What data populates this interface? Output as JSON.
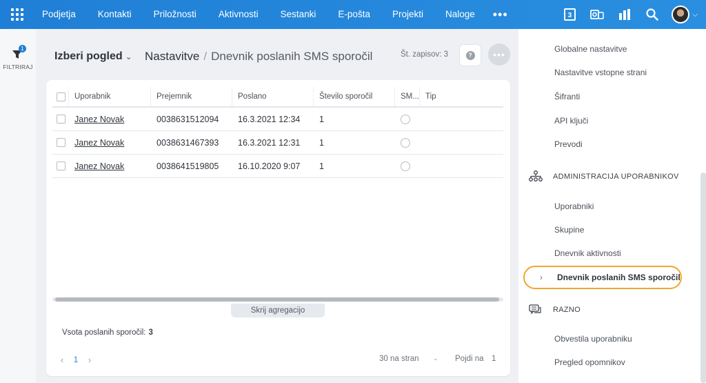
{
  "nav": {
    "items": [
      "Podjetja",
      "Kontakti",
      "Priložnosti",
      "Aktivnosti",
      "Sestanki",
      "E-pošta",
      "Projekti",
      "Naloge"
    ],
    "more": "•••",
    "calendar_day": "3"
  },
  "filter": {
    "badge": "1",
    "label": "FILTRIRAJ"
  },
  "header": {
    "view_select": "Izberi pogled",
    "crumb_parent": "Nastavitve",
    "crumb_sep": "/",
    "crumb_current": "Dnevnik poslanih SMS sporočil",
    "count": "Št. zapisov: 3",
    "help": "?"
  },
  "table": {
    "columns": [
      "Uporabnik",
      "Prejemnik",
      "Poslano",
      "Število sporočil",
      "SM...",
      "Tip"
    ],
    "rows": [
      {
        "user": "Janez Novak",
        "recipient": "0038631512094",
        "sent": "16.3.2021 12:34",
        "count": "1"
      },
      {
        "user": "Janez Novak",
        "recipient": "0038631467393",
        "sent": "16.3.2021 12:31",
        "count": "1"
      },
      {
        "user": "Janez Novak",
        "recipient": "0038641519805",
        "sent": "16.10.2020 9:07",
        "count": "1"
      }
    ]
  },
  "aggregation": {
    "toggle_label": "Skrij agregacijo",
    "sum_label": "Vsota poslanih sporočil:",
    "sum_value": "3"
  },
  "pager": {
    "page": "1",
    "per_page": "30 na stran",
    "goto_label": "Pojdi na",
    "goto_value": "1"
  },
  "right_panel": {
    "items_top": [
      "Globalne nastavitve",
      "Nastavitve vstopne strani",
      "Šifranti",
      "API ključi",
      "Prevodi"
    ],
    "section_admin": "ADMINISTRACIJA UPORABNIKOV",
    "items_admin": [
      "Uporabniki",
      "Skupine",
      "Dnevnik aktivnosti"
    ],
    "active_item": "Dnevnik poslanih SMS sporočil",
    "section_misc": "RAZNO",
    "items_misc": [
      "Obvestila uporabniku",
      "Pregled opomnikov"
    ]
  },
  "colors": {
    "nav_blue": "#1f7fd6",
    "active_outline": "#f2a52b",
    "page_link": "#1f7fd6"
  }
}
